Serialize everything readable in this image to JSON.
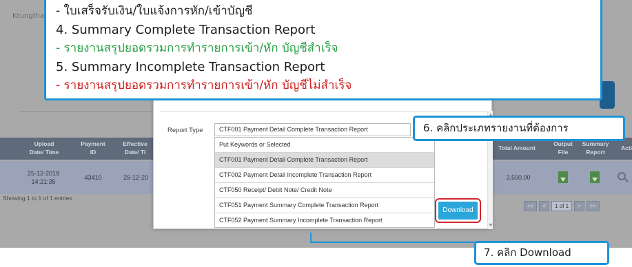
{
  "app": {
    "bank_name": "Krungthai",
    "table": {
      "headers": [
        {
          "line1": "Upload",
          "line2": "Date/ Time"
        },
        {
          "line1": "Payment",
          "line2": "ID"
        },
        {
          "line1": "Effective",
          "line2": "Date/ Ti"
        },
        {
          "line1": "Total Amount",
          "line2": ""
        },
        {
          "line1": "Output",
          "line2": "File"
        },
        {
          "line1": "Summary",
          "line2": "Report"
        },
        {
          "line1": "Acti",
          "line2": ""
        }
      ],
      "row": {
        "upload_date": "25-12-2019",
        "upload_time": "14:21:35",
        "payment_id": "43410",
        "effective_date": "25-12-20",
        "total_amount": "3,500.00"
      },
      "showing_text": "Showing 1 to 1 of 1 entries",
      "pager": {
        "first": "<<",
        "prev": "<",
        "current": "1 of 1",
        "next": ">",
        "last": ">>"
      }
    }
  },
  "modal": {
    "report_type_label": "Report Type",
    "selected_value": "CTF001 Payment Detail Complete Transaction Report",
    "options": [
      "Put Keywords or Selected",
      "CTF001 Payment Detail Complete Transaction Report",
      "CTF002 Payment Detail Incomplete Transaction Report",
      "CTF050 Receipt/ Debit Note/ Credit Note",
      "CTF051 Payment Summary Complete Transaction Report",
      "CTF052 Payment Summary Incomplete Transaction Report"
    ],
    "highlighted_option_index": 1,
    "download_label": "Download"
  },
  "callouts": {
    "top_lines": [
      {
        "text": "- ใบเสร็จรับเงิน/ใบแจ้งการหัก/เข้าบัญชี",
        "color": "#1e1e1e"
      },
      {
        "text": "4. Summary Complete Transaction Report",
        "color": "#1e1e1e"
      },
      {
        "text": "- รายงานสรุปยอดรวมการทำรายการเข้า/หัก บัญชีสำเร็จ",
        "color": "#27a046"
      },
      {
        "text": "5. Summary Incomplete Transaction Report",
        "color": "#1e1e1e"
      },
      {
        "text": "- รายงานสรุปยอดรวมการทำรายการเข้า/หัก บัญชีไม่สำเร็จ",
        "color": "#d02020"
      }
    ],
    "step6": "6. คลิกประเภทรายงานที่ต้องการ",
    "step7": "7. คลิก Download"
  },
  "colors": {
    "callout_border": "#1d93d6",
    "highlight_red": "#d0282e",
    "download_button": "#2aa6da",
    "table_header": "#5f6a7a"
  }
}
